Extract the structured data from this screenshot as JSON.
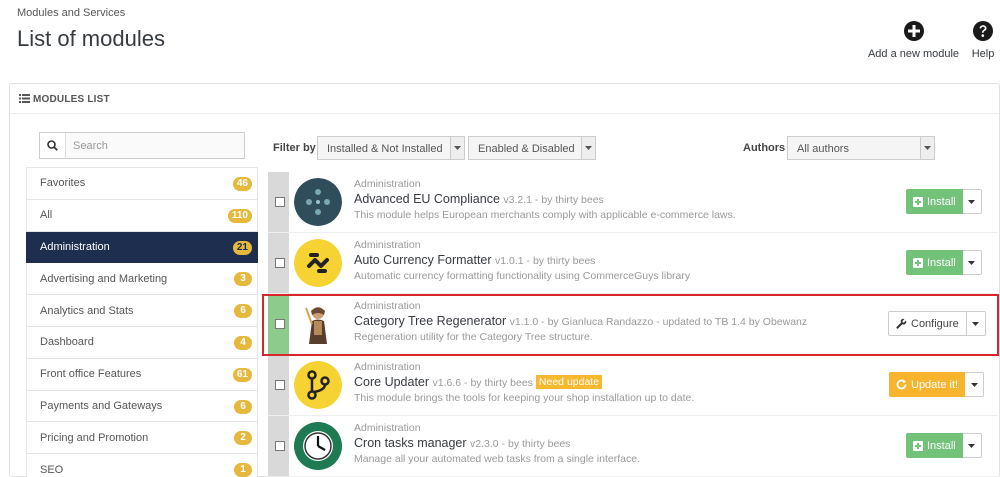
{
  "header": {
    "breadcrumb": "Modules and Services",
    "title": "List of modules",
    "add_module_label": "Add a new module",
    "help_label": "Help"
  },
  "panel": {
    "heading": "MODULES LIST"
  },
  "sidebar": {
    "search_placeholder": "Search",
    "categories": [
      {
        "label": "Favorites",
        "count": "46"
      },
      {
        "label": "All",
        "count": "110"
      },
      {
        "label": "Administration",
        "count": "21",
        "active": true
      },
      {
        "label": "Advertising and Marketing",
        "count": "3"
      },
      {
        "label": "Analytics and Stats",
        "count": "6"
      },
      {
        "label": "Dashboard",
        "count": "4"
      },
      {
        "label": "Front office Features",
        "count": "61"
      },
      {
        "label": "Payments and Gateways",
        "count": "6"
      },
      {
        "label": "Pricing and Promotion",
        "count": "2"
      },
      {
        "label": "SEO",
        "count": "1"
      }
    ]
  },
  "filters": {
    "label": "Filter by",
    "install_status": "Installed & Not Installed",
    "enable_status": "Enabled & Disabled",
    "authors_label": "Authors",
    "authors_value": "All authors"
  },
  "modules": [
    {
      "category": "Administration",
      "name": "Advanced EU Compliance",
      "meta": "v3.2.1 - by thirty bees",
      "description": "This module helps European merchants comply with applicable e-commerce laws.",
      "action": "Install",
      "action_type": "install",
      "installed": false,
      "need_update": ""
    },
    {
      "category": "Administration",
      "name": "Auto Currency Formatter",
      "meta": "v1.0.1 - by thirty bees",
      "description": "Automatic currency formatting functionality using CommerceGuys library",
      "action": "Install",
      "action_type": "install",
      "installed": false,
      "need_update": ""
    },
    {
      "category": "Administration",
      "name": "Category Tree Regenerator",
      "meta": "v1.1.0 - by Gianluca Randazzo - updated to TB 1.4 by Obewanz",
      "description": "Regeneration utility for the Category Tree structure.",
      "action": "Configure",
      "action_type": "configure",
      "installed": true,
      "need_update": ""
    },
    {
      "category": "Administration",
      "name": "Core Updater",
      "meta": "v1.6.6 - by thirty bees",
      "description": "This module brings the tools for keeping your shop installation up to date.",
      "action": "Update it!",
      "action_type": "update",
      "installed": false,
      "need_update": "Need update"
    },
    {
      "category": "Administration",
      "name": "Cron tasks manager",
      "meta": "v2.3.0 - by thirty bees",
      "description": "Manage all your automated web tasks from a single interface.",
      "action": "Install",
      "action_type": "install",
      "installed": false,
      "need_update": ""
    }
  ],
  "colors": {
    "active_category": "#1e2e4e",
    "badge": "#e6b83d",
    "install": "#72c279",
    "update": "#f9b42d",
    "installed_marker": "#8dcb8d",
    "highlight": "#d9262c"
  },
  "icons": {
    "add_module": "plus-circle-icon",
    "help": "question-circle-icon",
    "search": "search-icon",
    "list": "list-icon",
    "caret": "caret-down-icon",
    "install": "plus-square-icon",
    "configure": "wrench-icon",
    "update": "refresh-icon"
  }
}
